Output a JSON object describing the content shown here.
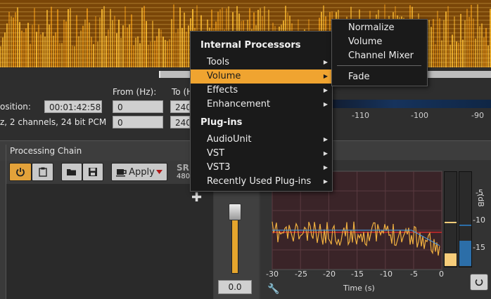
{
  "info": {
    "from_label": "From (Hz):",
    "to_label": "To (H",
    "position_label": "osition:",
    "position_value": "00:01:42:588",
    "from_value_1": "0",
    "to_value_1": "240",
    "format_label": "z, 2 channels, 24 bit PCM",
    "from_value_2": "0",
    "to_value_2": "240",
    "scale_ticks": [
      "-110",
      "-100",
      "-90"
    ]
  },
  "chain": {
    "title": "Processing Chain",
    "apply_label": "Apply",
    "sr_label": "SR",
    "sr_sub": "480"
  },
  "fader": {
    "value": "0.0"
  },
  "graph": {
    "x_ticks": [
      "-30",
      "-25",
      "-20",
      "-15",
      "-10",
      "-5",
      "0"
    ],
    "y_ticks": [
      "-5",
      "-10",
      "-15"
    ],
    "xlabel": "Time (s)"
  },
  "meters": {
    "side_label": "(dB"
  },
  "menu": {
    "header_internal": "Internal Processors",
    "items_internal": [
      {
        "label": "Tools",
        "active": false
      },
      {
        "label": "Volume",
        "active": true
      },
      {
        "label": "Effects",
        "active": false
      },
      {
        "label": "Enhancement",
        "active": false
      }
    ],
    "header_plugins": "Plug-ins",
    "items_plugins": [
      {
        "label": "AudioUnit"
      },
      {
        "label": "VST"
      },
      {
        "label": "VST3"
      },
      {
        "label": "Recently Used Plug-ins"
      }
    ]
  },
  "submenu": {
    "items": [
      "Normalize",
      "Volume",
      "Channel Mixer"
    ],
    "fade": "Fade"
  },
  "colors": {
    "accent": "#f0a430",
    "spectrogram": "#e9a021",
    "meter_blue": "#2c6ea8"
  },
  "icons": {
    "power": "power-icon",
    "clipboard": "clipboard-icon",
    "folder": "folder-icon",
    "save": "save-icon",
    "apply": "coffee-cup-icon",
    "plus": "plus-icon",
    "wrench": "wrench-icon",
    "reset": "reset-icon"
  }
}
